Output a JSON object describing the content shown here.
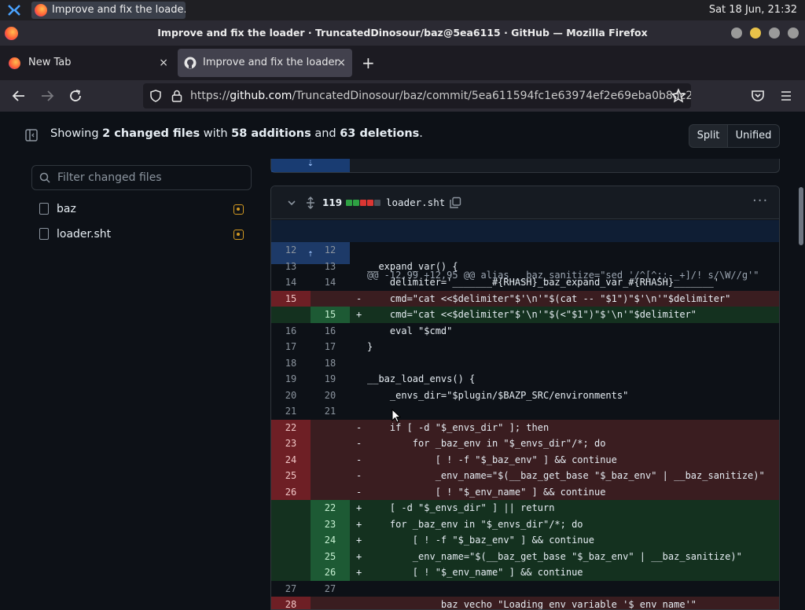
{
  "os": {
    "task_title": "Improve and fix the loade...",
    "clock": "Sat 18 Jun, 21:32"
  },
  "window": {
    "title": "Improve and fix the loader · TruncatedDinosour/baz@5ea6115 · GitHub — Mozilla Firefox"
  },
  "tabs": [
    {
      "label": "New Tab",
      "close": "×"
    },
    {
      "label": "Improve and fix the loader",
      "close": "×"
    }
  ],
  "new_tab_label": "+",
  "url": {
    "prefix": "https://",
    "host": "github.com",
    "path": "/TruncatedDinosour/baz/commit/5ea611594fc1e63974ef2e69eba0b8dc2"
  },
  "summary": {
    "showing": "Showing",
    "files": "2 changed files",
    "with": "with",
    "additions": "58 additions",
    "and": "and",
    "deletions": "63 deletions",
    "end": "."
  },
  "view_toggle": {
    "split": "Split",
    "unified": "Unified"
  },
  "filter": {
    "placeholder": "Filter changed files"
  },
  "file_tree": [
    {
      "name": "baz"
    },
    {
      "name": "loader.sht"
    }
  ],
  "diff": {
    "count": "119",
    "filename": "loader.sht",
    "colors": {
      "add": "#2ea043",
      "del": "#da3633",
      "neutral": "#484f58"
    },
    "hunk": "@@ -12,99 +12,95 @@ alias __baz_sanitize=\"sed '/^[^;:-_+]/! s/\\W//g'\"",
    "lines": [
      {
        "t": "ctx",
        "l": "12",
        "r": "12",
        "s": "",
        "c": ""
      },
      {
        "t": "ctx",
        "l": "13",
        "r": "13",
        "s": "",
        "c": "__expand_var() {"
      },
      {
        "t": "ctx",
        "l": "14",
        "r": "14",
        "s": "",
        "c": "    delimiter='_______#{RHASH}_baz_expand_var_#{RHASH}_______'"
      },
      {
        "t": "del",
        "l": "15",
        "r": "",
        "s": "-",
        "c": "    cmd=\"cat <<$delimiter\"$'\\n'\"$(cat -- \"$1\")\"$'\\n'\"$delimiter\""
      },
      {
        "t": "add",
        "l": "",
        "r": "15",
        "s": "+",
        "c": "    cmd=\"cat <<$delimiter\"$'\\n'\"$(<\"$1\")\"$'\\n'\"$delimiter\""
      },
      {
        "t": "ctx",
        "l": "16",
        "r": "16",
        "s": "",
        "c": "    eval \"$cmd\""
      },
      {
        "t": "ctx",
        "l": "17",
        "r": "17",
        "s": "",
        "c": "}"
      },
      {
        "t": "ctx",
        "l": "18",
        "r": "18",
        "s": "",
        "c": ""
      },
      {
        "t": "ctx",
        "l": "19",
        "r": "19",
        "s": "",
        "c": "__baz_load_envs() {"
      },
      {
        "t": "ctx",
        "l": "20",
        "r": "20",
        "s": "",
        "c": "    _envs_dir=\"$plugin/$BAZP_SRC/environments\""
      },
      {
        "t": "ctx",
        "l": "21",
        "r": "21",
        "s": "",
        "c": ""
      },
      {
        "t": "del",
        "l": "22",
        "r": "",
        "s": "-",
        "c": "    if [ -d \"$_envs_dir\" ]; then"
      },
      {
        "t": "del",
        "l": "23",
        "r": "",
        "s": "-",
        "c": "        for _baz_env in \"$_envs_dir\"/*; do"
      },
      {
        "t": "del",
        "l": "24",
        "r": "",
        "s": "-",
        "c": "            [ ! -f \"$_baz_env\" ] && continue"
      },
      {
        "t": "del",
        "l": "25",
        "r": "",
        "s": "-",
        "c": "            _env_name=\"$(__baz_get_base \"$_baz_env\" | __baz_sanitize)\""
      },
      {
        "t": "del",
        "l": "26",
        "r": "",
        "s": "-",
        "c": "            [ ! \"$_env_name\" ] && continue"
      },
      {
        "t": "add",
        "l": "",
        "r": "22",
        "s": "+",
        "c": "    [ -d \"$_envs_dir\" ] || return"
      },
      {
        "t": "add",
        "l": "",
        "r": "23",
        "s": "+",
        "c": "    for _baz_env in \"$_envs_dir\"/*; do"
      },
      {
        "t": "add",
        "l": "",
        "r": "24",
        "s": "+",
        "c": "        [ ! -f \"$_baz_env\" ] && continue"
      },
      {
        "t": "add",
        "l": "",
        "r": "25",
        "s": "+",
        "c": "        _env_name=\"$(__baz_get_base \"$_baz_env\" | __baz_sanitize)\""
      },
      {
        "t": "add",
        "l": "",
        "r": "26",
        "s": "+",
        "c": "        [ ! \"$_env_name\" ] && continue"
      },
      {
        "t": "ctx",
        "l": "27",
        "r": "27",
        "s": "",
        "c": ""
      },
      {
        "t": "del",
        "l": "28",
        "r": "",
        "s": "",
        "c": "            _baz_vecho \"Loading env variable '$_env_name'\""
      }
    ]
  }
}
